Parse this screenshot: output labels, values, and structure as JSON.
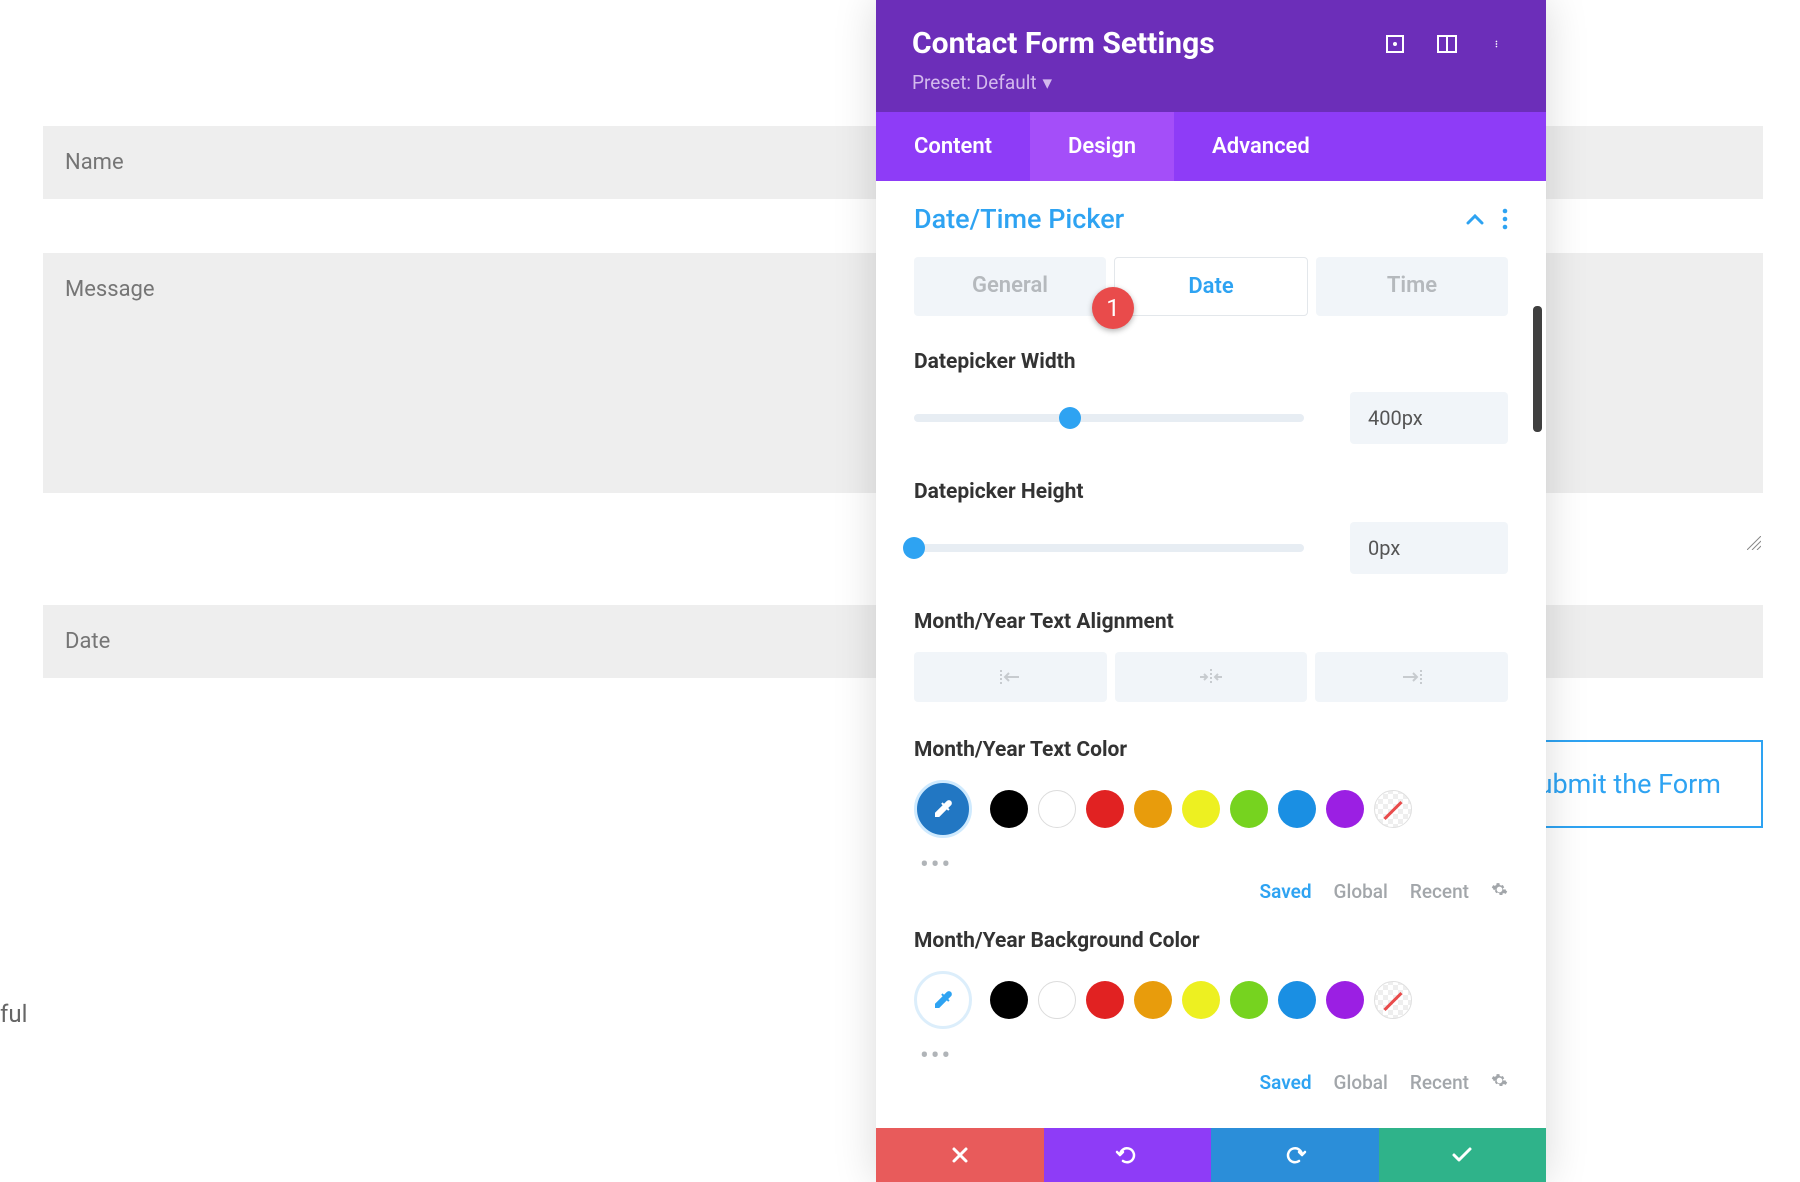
{
  "form": {
    "fields": {
      "name_placeholder": "Name",
      "message_placeholder": "Message",
      "date_placeholder": "Date"
    },
    "submit_label": "Submit the Form",
    "partial_text": "ful"
  },
  "panel": {
    "title": "Contact Form Settings",
    "preset_label": "Preset: Default",
    "tabs": {
      "content": "Content",
      "design": "Design",
      "advanced": "Advanced"
    },
    "section": {
      "title": "Date/Time Picker",
      "subtabs": {
        "general": "General",
        "date": "Date",
        "time": "Time"
      },
      "badge": "1"
    },
    "controls": {
      "width_label": "Datepicker Width",
      "width_value": "400px",
      "width_pct": 40,
      "height_label": "Datepicker Height",
      "height_value": "0px",
      "height_pct": 0,
      "align_label": "Month/Year Text Alignment",
      "text_color_label": "Month/Year Text Color",
      "bg_color_label": "Month/Year Background Color"
    },
    "color_swatches": [
      "#000000",
      "#ffffff",
      "#e12222",
      "#e89c0c",
      "#edf021",
      "#76d31f",
      "#1a8fe3",
      "#9b1fe3"
    ],
    "color_meta": {
      "saved": "Saved",
      "global": "Global",
      "recent": "Recent"
    }
  }
}
